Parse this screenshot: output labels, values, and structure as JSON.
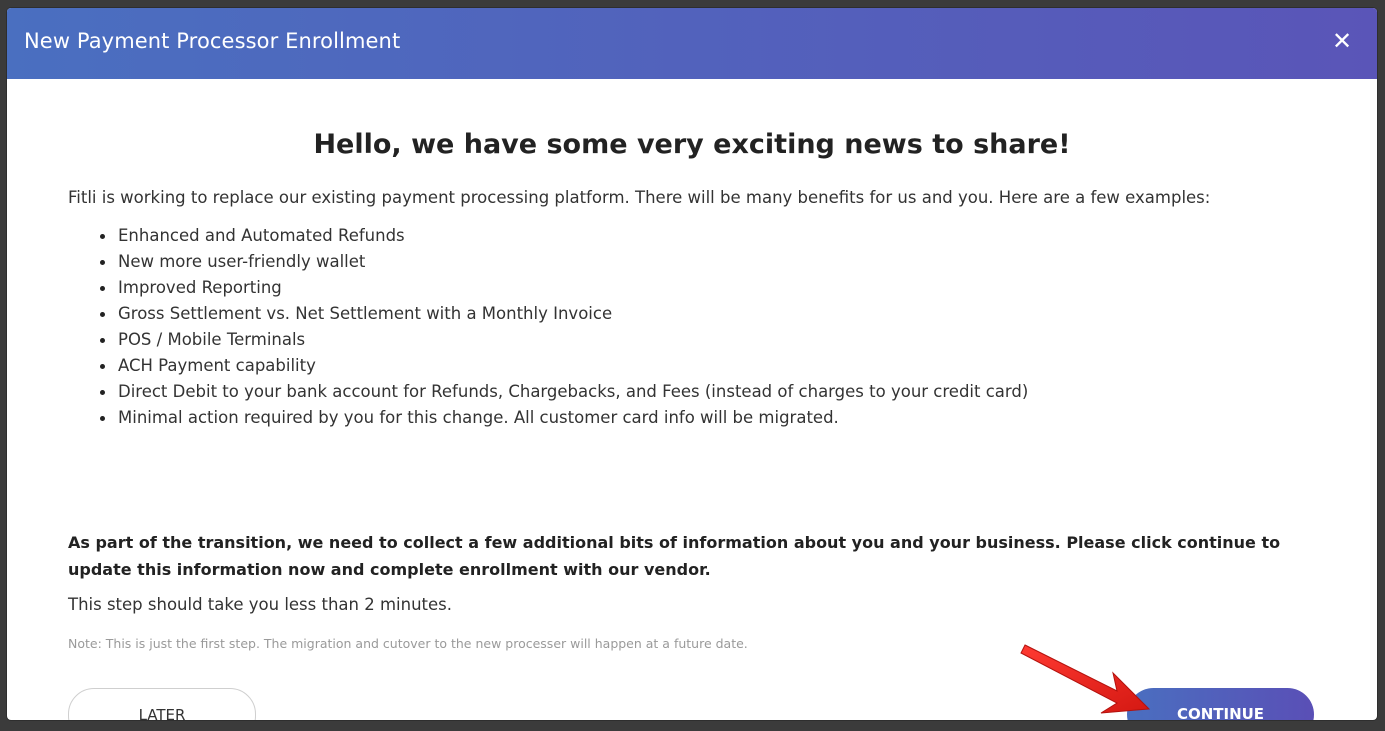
{
  "modal": {
    "title": "New Payment Processor Enrollment",
    "close_icon": "close-icon",
    "close_glyph": "✕"
  },
  "content": {
    "headline": "Hello, we have some very exciting news to share!",
    "intro": "Fitli is working to replace our existing payment processing platform. There will be many benefits for us and you. Here are a few examples:",
    "benefits": [
      "Enhanced and Automated Refunds",
      "New more user-friendly wallet",
      "Improved Reporting",
      "Gross Settlement vs. Net Settlement with a Monthly Invoice",
      "POS / Mobile Terminals",
      "ACH Payment capability",
      "Direct Debit to your bank account for Refunds, Chargebacks, and Fees (instead of charges to your credit card)",
      "Minimal action required by you for this change. All customer card info will be migrated."
    ],
    "bold_note": "As part of the transition, we need to collect a few additional bits of information about you and your business. Please click continue to update this information now and complete enrollment with our vendor.",
    "step_text": "This step should take you less than 2 minutes.",
    "small_note": "Note: This is just the first step. The migration and cutover to the new processer will happen at a future date."
  },
  "buttons": {
    "later_label": "LATER",
    "continue_label": "CONTINUE"
  },
  "colors": {
    "header_gradient_start": "#4a6fc0",
    "header_gradient_end": "#5a55b8",
    "arrow_red": "#e8211e"
  },
  "annotation": {
    "icon": "red-arrow-icon"
  }
}
